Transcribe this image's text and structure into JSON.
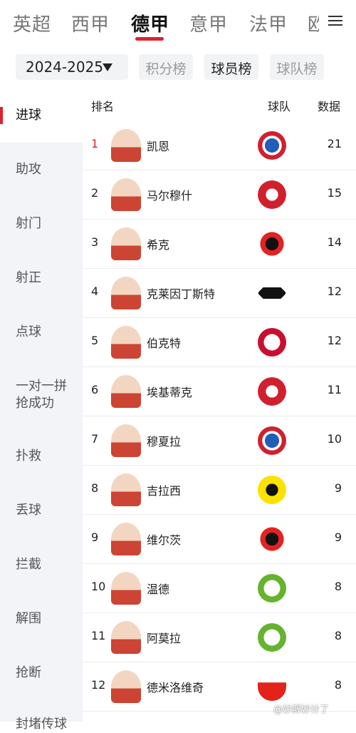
{
  "top_nav": {
    "leagues": [
      "英超",
      "西甲",
      "德甲",
      "意甲",
      "法甲",
      "欧"
    ],
    "active_index": 2
  },
  "filters": {
    "season": "2024-2025",
    "tabs": [
      "积分榜",
      "球员榜",
      "球队榜"
    ],
    "active_tab_index": 1
  },
  "sidebar": {
    "items": [
      "进球",
      "助攻",
      "射门",
      "射正",
      "点球",
      "一对一拼抢成功",
      "扑救",
      "丢球",
      "拦截",
      "解围",
      "抢断",
      "封堵传球"
    ],
    "active_index": 0
  },
  "table": {
    "headers": {
      "rank": "排名",
      "team": "球队",
      "value": "数据"
    },
    "rows": [
      {
        "rank": "1",
        "name": "凯恩",
        "team": "bayern-crest",
        "value": "21"
      },
      {
        "rank": "2",
        "name": "马尔穆什",
        "team": "frankfurt-crest",
        "value": "15"
      },
      {
        "rank": "3",
        "name": "希克",
        "team": "leverkusen-crest",
        "value": "14"
      },
      {
        "rank": "4",
        "name": "克莱因丁斯特",
        "team": "gladbach-crest",
        "value": "12"
      },
      {
        "rank": "5",
        "name": "伯克特",
        "team": "mainz-crest",
        "value": "12"
      },
      {
        "rank": "6",
        "name": "埃基蒂克",
        "team": "frankfurt-crest",
        "value": "11"
      },
      {
        "rank": "7",
        "name": "穆夏拉",
        "team": "bayern-crest",
        "value": "10"
      },
      {
        "rank": "8",
        "name": "吉拉西",
        "team": "dortmund-crest",
        "value": "9"
      },
      {
        "rank": "9",
        "name": "维尔茨",
        "team": "leverkusen-crest",
        "value": "9"
      },
      {
        "rank": "10",
        "name": "温德",
        "team": "wolfsburg-crest",
        "value": "8"
      },
      {
        "rank": "11",
        "name": "阿莫拉",
        "team": "wolfsburg-crest",
        "value": "8"
      },
      {
        "rank": "12",
        "name": "德米洛维奇",
        "team": "stuttgart-crest",
        "value": "8"
      }
    ]
  },
  "colors": {
    "accent": "#e0202e",
    "sidebar_bg": "#f2f4f8",
    "chip_bg": "#f2f3f5"
  },
  "watermark": "@妙解妙计了"
}
